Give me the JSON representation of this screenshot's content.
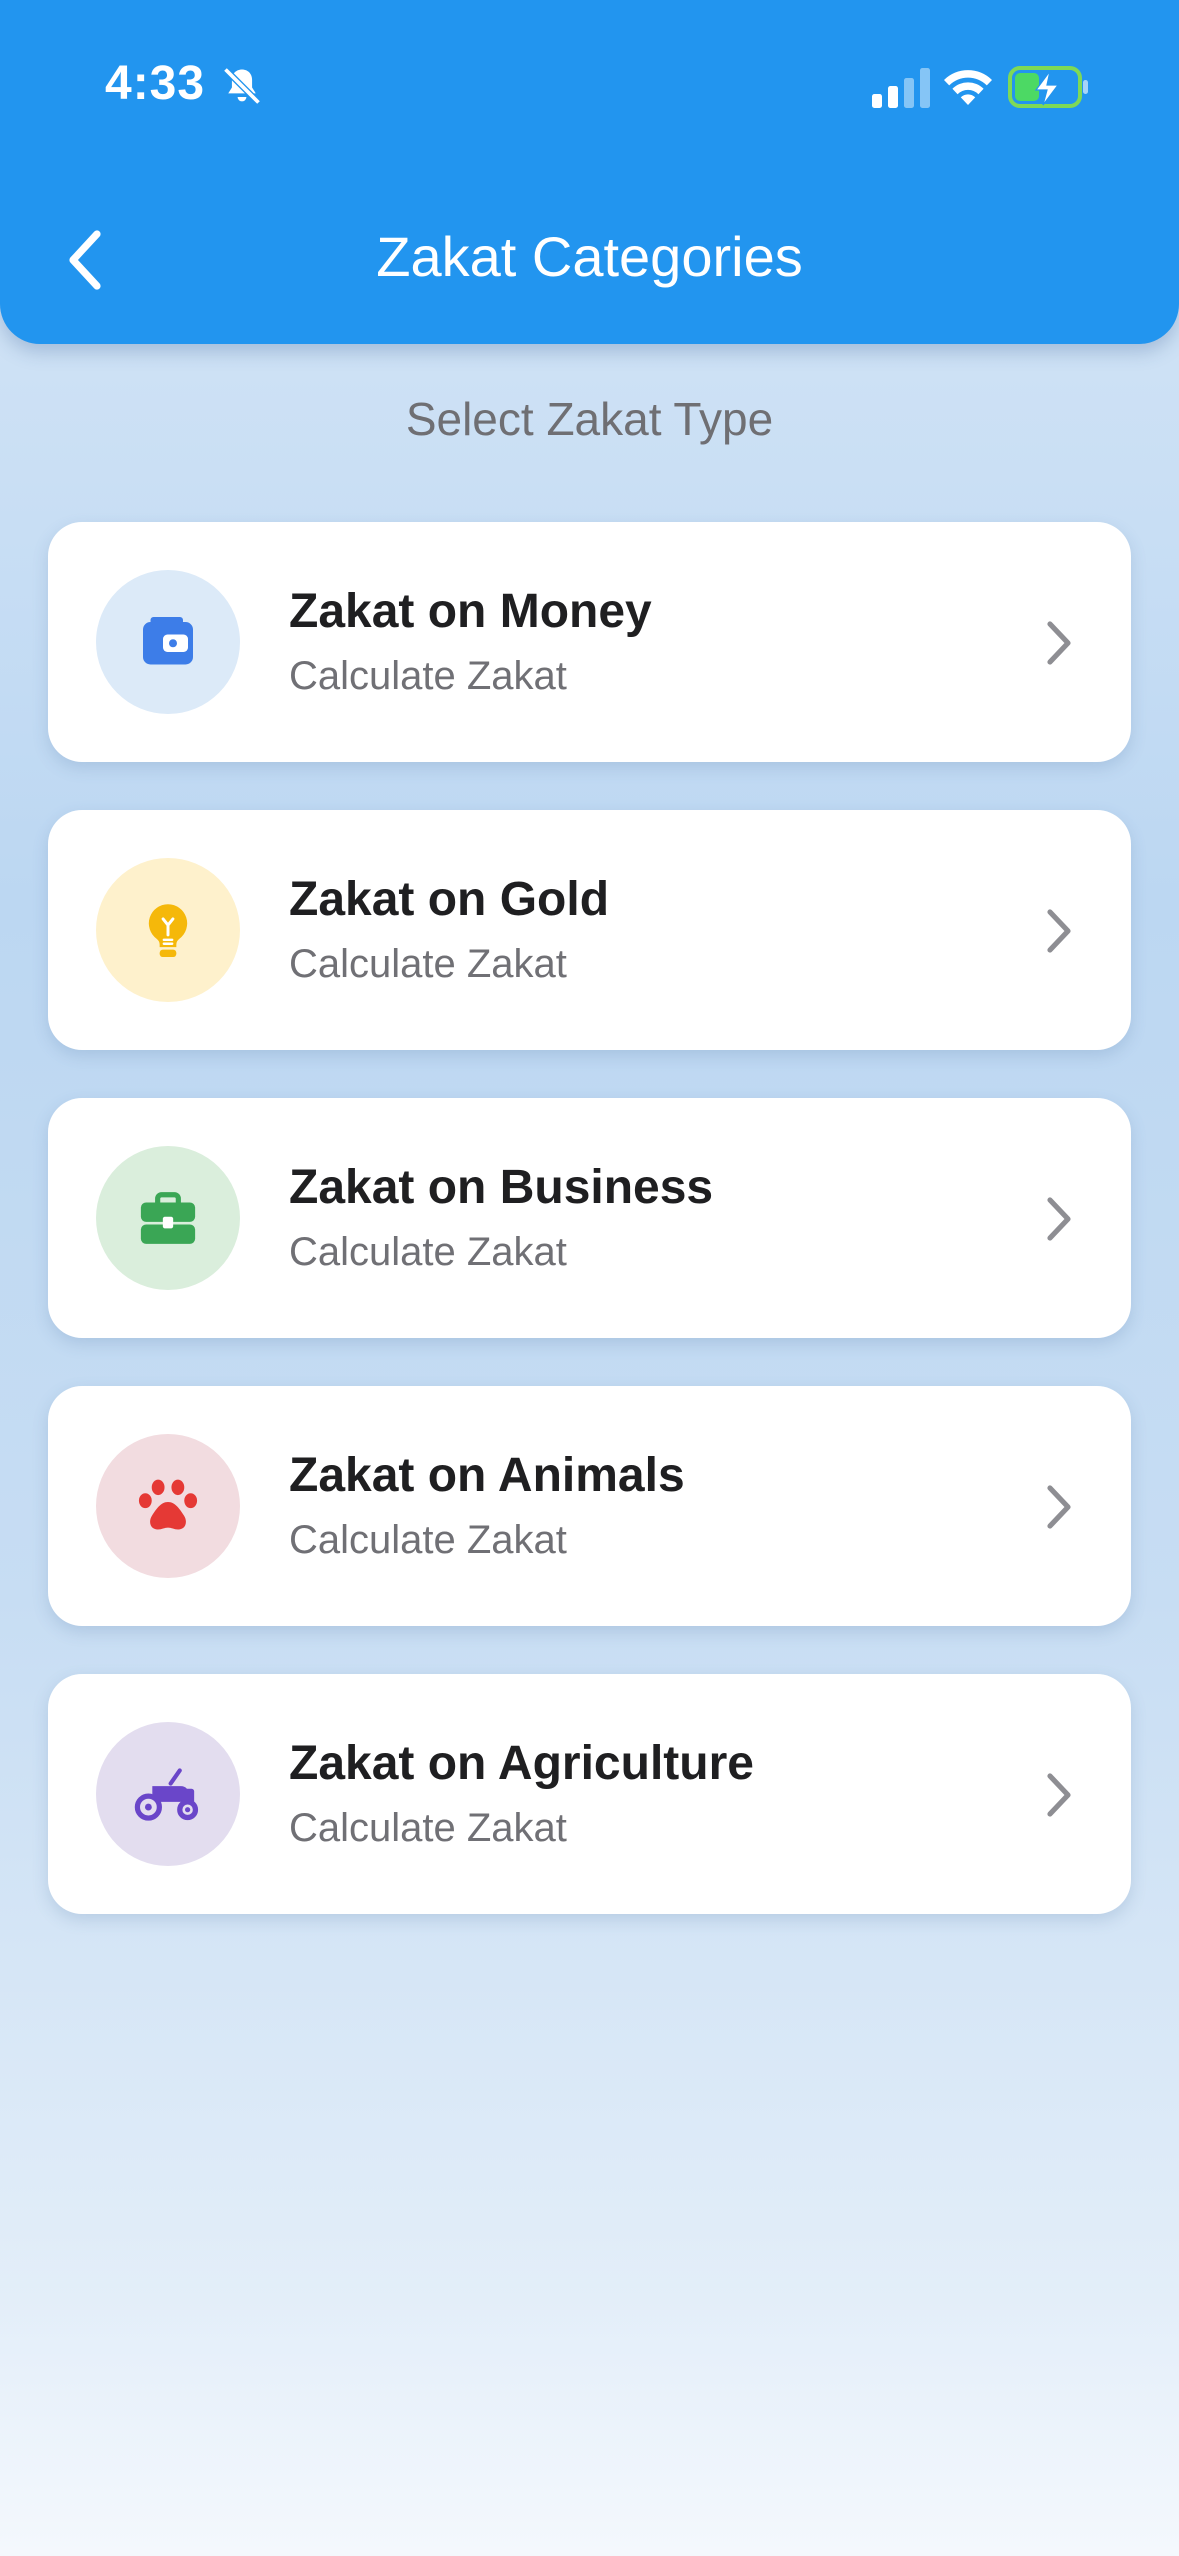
{
  "status_bar": {
    "time": "4:33"
  },
  "header": {
    "title": "Zakat Categories"
  },
  "section": {
    "title": "Select Zakat Type"
  },
  "categories": [
    {
      "title": "Zakat on Money",
      "subtitle": "Calculate Zakat",
      "icon": "wallet-icon",
      "color": "#3d7de8",
      "bg": "#dceaf8"
    },
    {
      "title": "Zakat on Gold",
      "subtitle": "Calculate Zakat",
      "icon": "lightbulb-icon",
      "color": "#f5b80a",
      "bg": "#fef1cc"
    },
    {
      "title": "Zakat on Business",
      "subtitle": "Calculate Zakat",
      "icon": "briefcase-icon",
      "color": "#3aa655",
      "bg": "#daeedc"
    },
    {
      "title": "Zakat on Animals",
      "subtitle": "Calculate Zakat",
      "icon": "paw-icon",
      "color": "#e53935",
      "bg": "#f2dce0"
    },
    {
      "title": "Zakat on Agriculture",
      "subtitle": "Calculate Zakat",
      "icon": "tractor-icon",
      "color": "#6a46c9",
      "bg": "#e3ddef"
    }
  ],
  "colors": {
    "header": "#2295ef",
    "card": "#ffffff",
    "title_text": "#1f1f21",
    "subtitle_text": "#707075"
  }
}
